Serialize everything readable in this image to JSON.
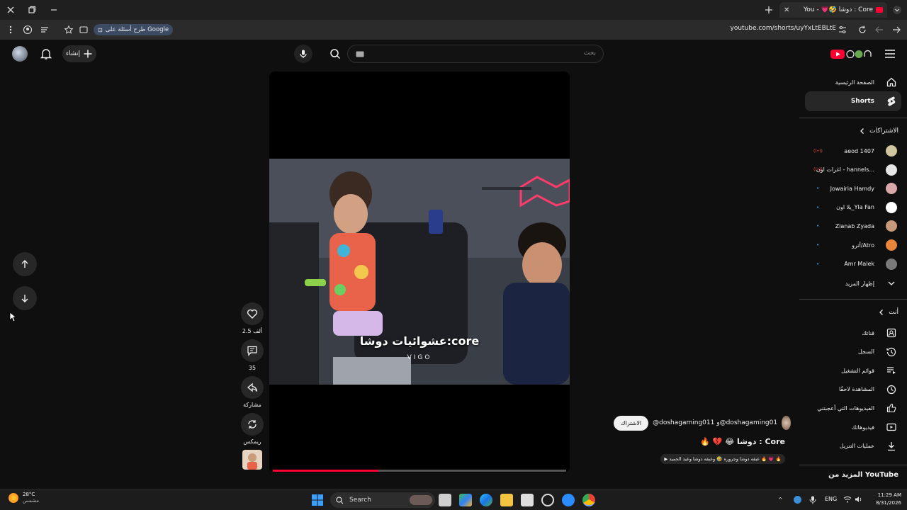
{
  "browser": {
    "tab_title": "Core : دوشا 🤣💗 - You",
    "url": "youtube.com/shorts/uyYxLtEBLtE",
    "google_chip": "طرح أسئلة على Google"
  },
  "masthead": {
    "search_placeholder": "بحث",
    "create_label": "إنشاء"
  },
  "video": {
    "caption": "عشوائيات دوشا:core",
    "watermark": "VIGO",
    "progress_percent": 36
  },
  "actions": {
    "like_count": "2.5 ألف",
    "comment_count": "35",
    "share_label": "مشاركة",
    "remix_label": "ريمكس"
  },
  "channel": {
    "name": "@doshagaming011 و@doshagaming01",
    "subscribe_label": "الاشتراك",
    "video_title": "🔥 💔 😂 دوشا : Core",
    "tag_line": "▶ عبقه دوشا وجروره 🤣 وعبقه دوشا وعيد الحميد 🔥 💗 🔥"
  },
  "sidebar": {
    "home": "الصفحة الرئيسية",
    "shorts": "Shorts",
    "subscriptions_header": "الاشتراكات",
    "subscriptions": [
      {
        "name": "aeod 1407",
        "badge": "live",
        "color": "#d0c7a0"
      },
      {
        "name": "اغرات اون - hannels...",
        "badge": "live",
        "color": "#e6e6e6"
      },
      {
        "name": "Jowairia Hamdy",
        "badge": "dot",
        "color": "#d9a9a9"
      },
      {
        "name": "يلا اون_Yla Fan",
        "badge": "dot",
        "color": "#ffffff"
      },
      {
        "name": "Zianab Zyada",
        "badge": "dot",
        "color": "#c79a7a"
      },
      {
        "name": "أترو/Atro",
        "badge": "dot",
        "color": "#e8843c"
      },
      {
        "name": "Amr Malek",
        "badge": "dot",
        "color": "#7a7a7a"
      }
    ],
    "show_more": "إظهار المزيد",
    "you_header": "أنت",
    "you_items": [
      "قناتك",
      "السجل",
      "قوائم التشغيل",
      "المشاهدة لاحقًا",
      "الفيديوهات التي أعجبتني",
      "فيديوهاتك",
      "عمليات التنزيل"
    ],
    "more_from_youtube": "المزيد من YouTube"
  },
  "taskbar": {
    "weather_temp": "28°C",
    "weather_desc": "مشمس",
    "search_label": "Search",
    "lang": "ENG",
    "time": "11:29 AM",
    "date": "8/31/2026"
  }
}
